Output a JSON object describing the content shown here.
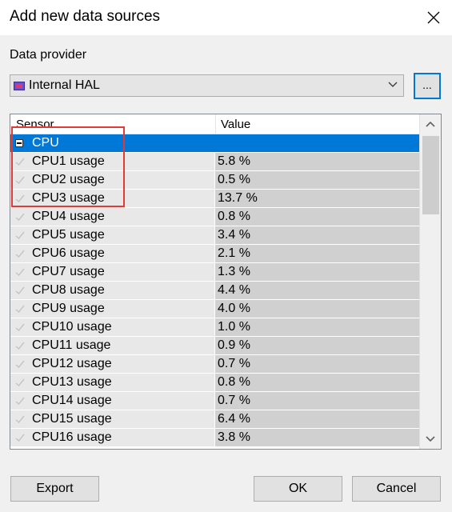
{
  "window": {
    "title": "Add new data sources",
    "close_icon": "close-icon"
  },
  "provider": {
    "label": "Data provider",
    "selected": "Internal HAL",
    "browse_label": "..."
  },
  "grid": {
    "columns": [
      "Sensor",
      "Value"
    ],
    "group": "CPU",
    "rows": [
      {
        "sensor": "CPU1 usage",
        "value": "5.8 %"
      },
      {
        "sensor": "CPU2 usage",
        "value": "0.5 %"
      },
      {
        "sensor": "CPU3 usage",
        "value": "13.7 %"
      },
      {
        "sensor": "CPU4 usage",
        "value": "0.8 %"
      },
      {
        "sensor": "CPU5 usage",
        "value": "3.4 %"
      },
      {
        "sensor": "CPU6 usage",
        "value": "2.1 %"
      },
      {
        "sensor": "CPU7 usage",
        "value": "1.3 %"
      },
      {
        "sensor": "CPU8 usage",
        "value": "4.4 %"
      },
      {
        "sensor": "CPU9 usage",
        "value": "4.0 %"
      },
      {
        "sensor": "CPU10 usage",
        "value": "1.0 %"
      },
      {
        "sensor": "CPU11 usage",
        "value": "0.9 %"
      },
      {
        "sensor": "CPU12 usage",
        "value": "0.7 %"
      },
      {
        "sensor": "CPU13 usage",
        "value": "0.8 %"
      },
      {
        "sensor": "CPU14 usage",
        "value": "0.7 %"
      },
      {
        "sensor": "CPU15 usage",
        "value": "6.4 %"
      },
      {
        "sensor": "CPU16 usage",
        "value": "3.8 %"
      }
    ]
  },
  "buttons": {
    "export": "Export",
    "ok": "OK",
    "cancel": "Cancel"
  },
  "colors": {
    "selection": "#0078d7",
    "annotation": "#e53935"
  }
}
